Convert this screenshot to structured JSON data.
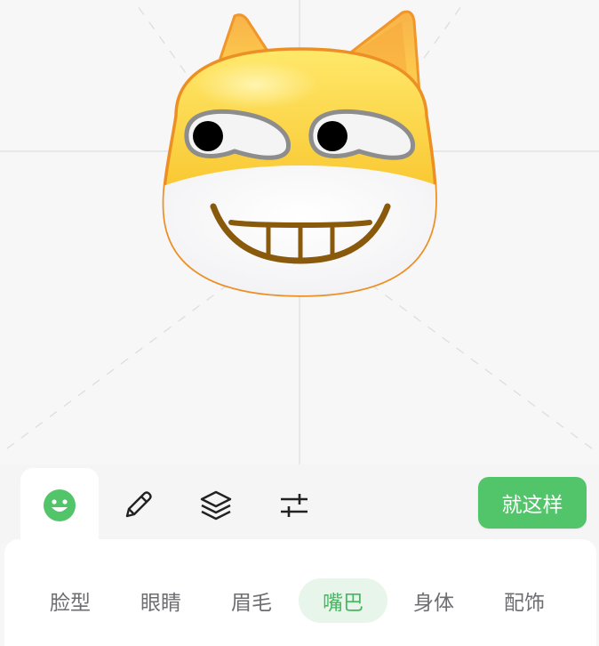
{
  "toolbar": {
    "tools": [
      {
        "name": "face",
        "icon": "smiley-icon",
        "active": true
      },
      {
        "name": "draw",
        "icon": "pencil-icon",
        "active": false
      },
      {
        "name": "layers",
        "icon": "layers-icon",
        "active": false
      },
      {
        "name": "adjust",
        "icon": "sliders-icon",
        "active": false
      }
    ],
    "done_label": "就这样"
  },
  "tabs": {
    "items": [
      "脸型",
      "眼睛",
      "眉毛",
      "嘴巴",
      "身体",
      "配饰"
    ],
    "selected": "嘴巴"
  },
  "colors": {
    "accent": "#52c46a",
    "tab_selected_bg": "#e7f5ea",
    "tab_selected_text": "#46b860",
    "tab_text": "#6d6d72"
  }
}
